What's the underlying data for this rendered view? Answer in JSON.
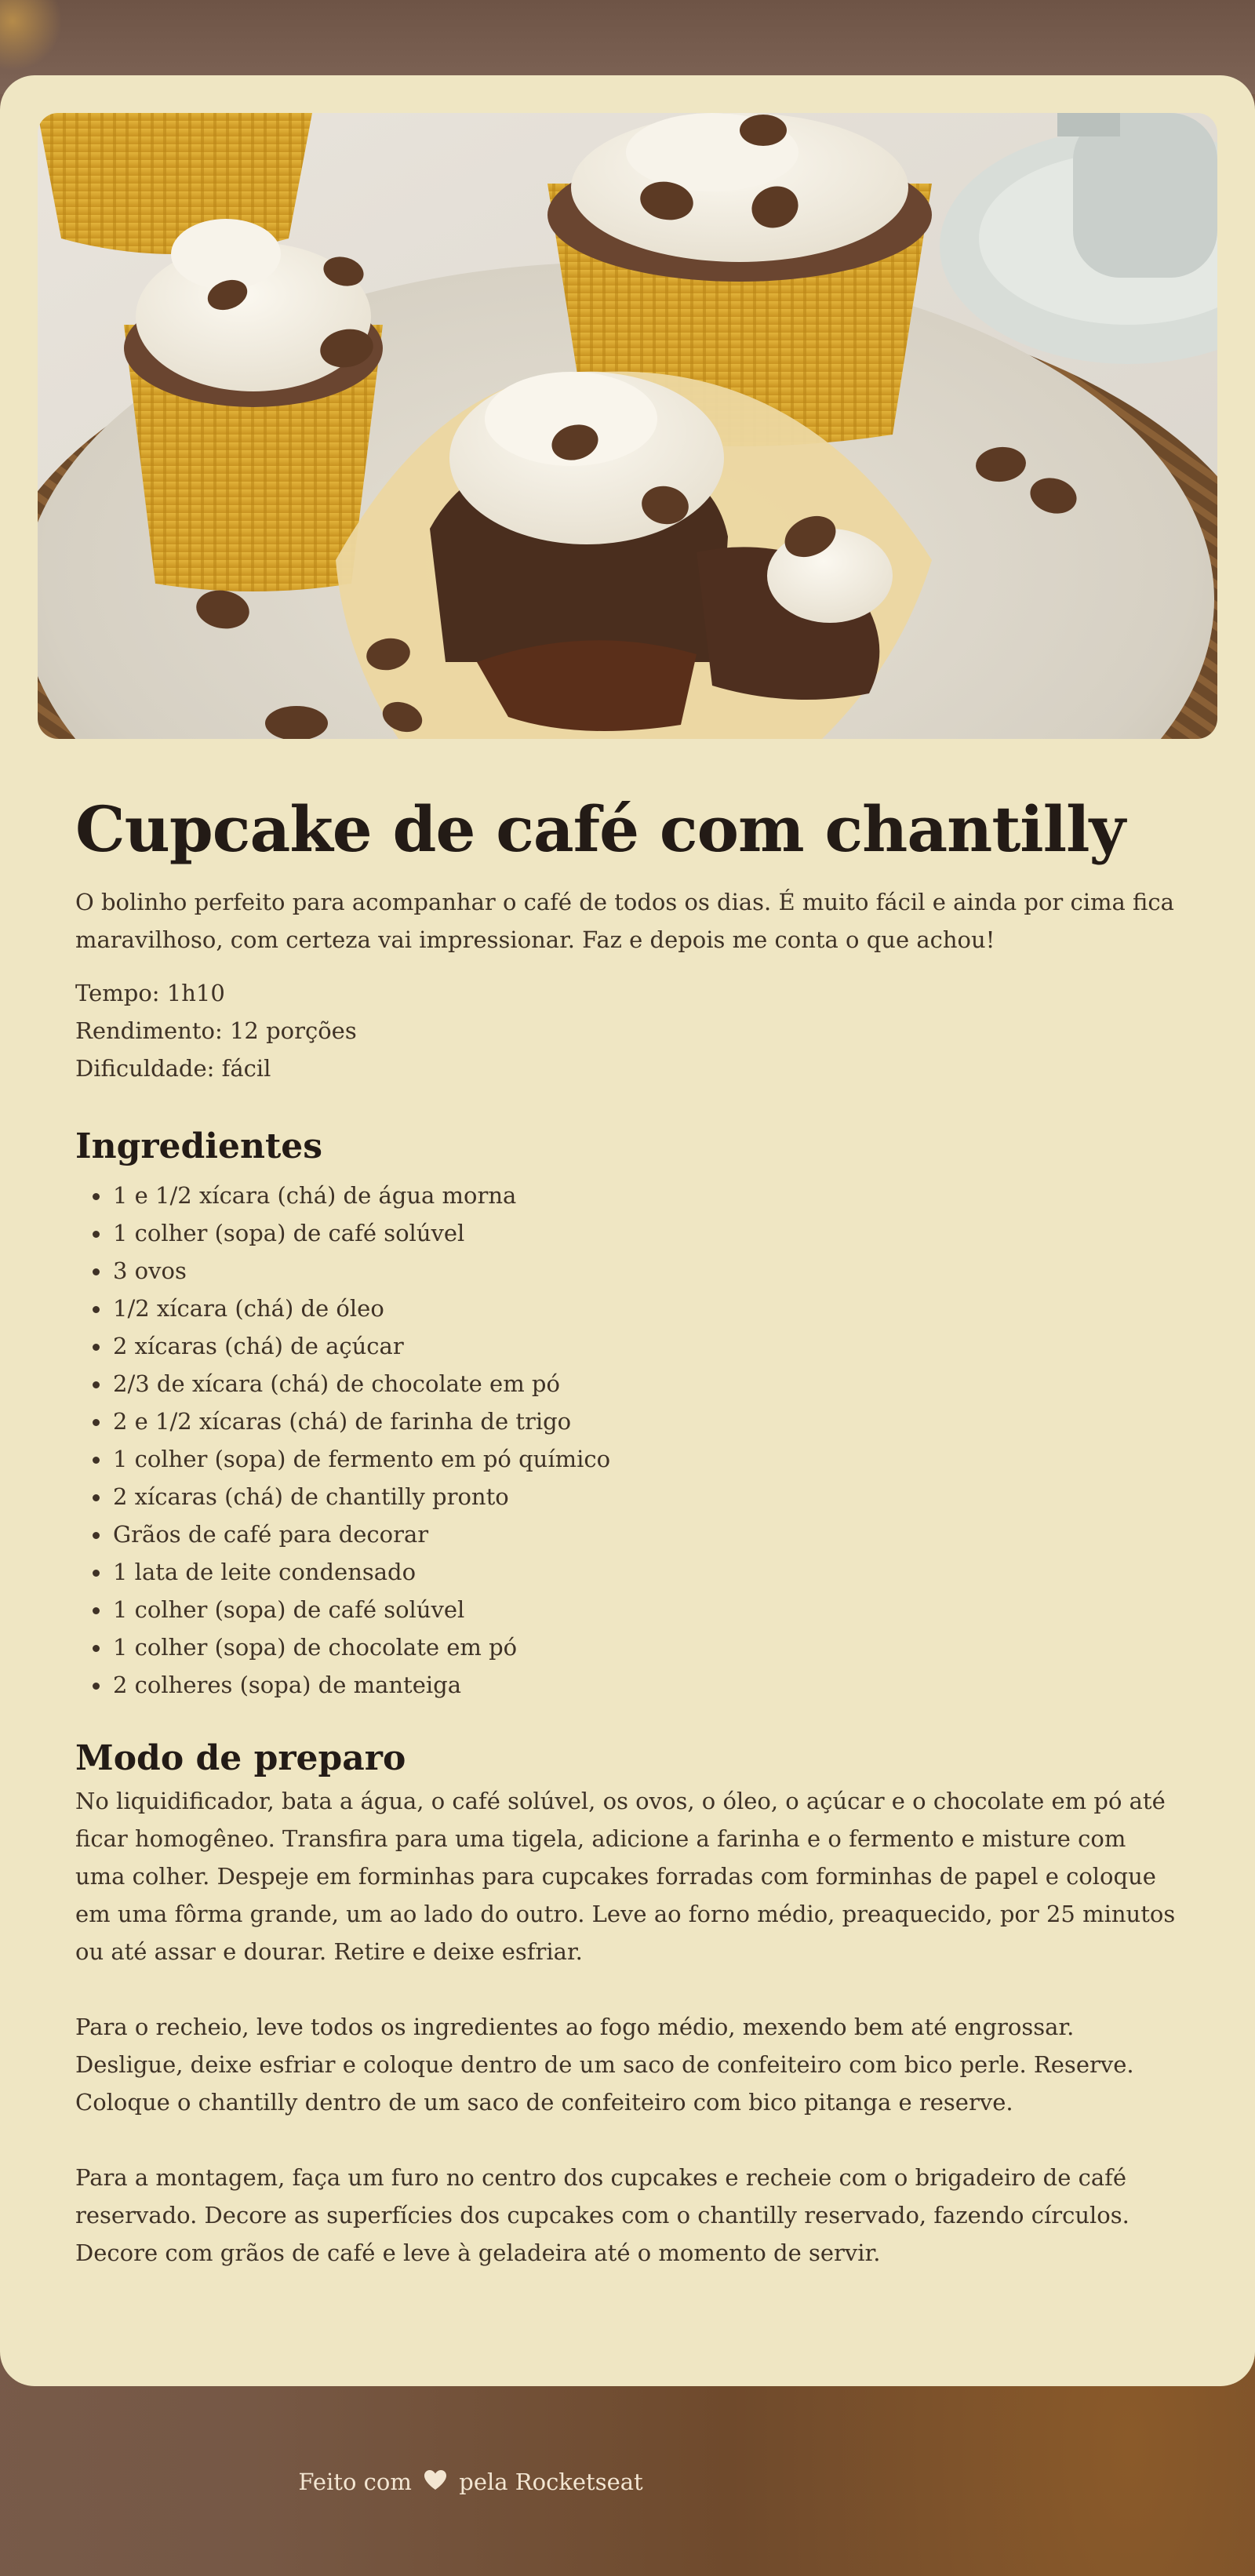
{
  "recipe": {
    "title": "Cupcake de café com chantilly",
    "description": "O bolinho perfeito para acompanhar o café de todos os dias. É muito fácil e ainda por cima fica maravilhoso, com certeza vai impressionar. Faz e depois me conta o que achou!",
    "time": "Tempo: 1h10",
    "yield": "Rendimento: 12 porções",
    "difficulty": "Dificuldade: fácil"
  },
  "ingredients": {
    "heading": "Ingredientes",
    "items": [
      "1 e 1/2 xícara (chá) de água morna",
      "1 colher (sopa) de café solúvel",
      "3 ovos",
      "1/2 xícara (chá) de óleo",
      "2 xícaras (chá) de açúcar",
      "2/3 de xícara (chá) de chocolate em pó",
      "2 e 1/2 xícaras (chá) de farinha de trigo",
      "1 colher (sopa) de fermento em pó químico",
      "2 xícaras (chá) de chantilly pronto",
      "Grãos de café para decorar",
      "1 lata de leite condensado",
      "1 colher (sopa) de café solúvel",
      "1 colher (sopa) de chocolate em pó",
      "2 colheres (sopa) de manteiga"
    ]
  },
  "preparation": {
    "heading": "Modo de preparo",
    "steps": [
      "No liquidificador, bata a água, o café solúvel, os ovos, o óleo, o açúcar e o chocolate em pó até ficar homogêneo. Transfira para uma tigela, adicione a farinha e o fermento e misture com uma colher. Despeje em forminhas para cupcakes forradas com forminhas de papel e coloque em uma fôrma grande, um ao lado do outro. Leve ao forno médio, preaquecido, por 25 minutos ou até assar e dourar. Retire e deixe esfriar.",
      "Para o recheio, leve todos os ingredientes ao fogo médio, mexendo bem até engrossar. Desligue, deixe esfriar e coloque dentro de um saco de confeiteiro com bico perle. Reserve. Coloque o chantilly dentro de um saco de confeiteiro com bico pitanga e reserve.",
      "Para a montagem, faça um furo no centro dos cupcakes e recheie com o brigadeiro de café reservado. Decore as superfícies dos cupcakes com o chantilly reservado, fazendo círculos. Decore com grãos de café e leve à geladeira até o momento de servir."
    ]
  },
  "footer": {
    "made_with": "Feito com",
    "by": "pela Rocketseat",
    "icon": "heart-icon"
  },
  "colors": {
    "card_background": "#efe6c3",
    "heading_text": "#231b16",
    "body_text": "#3f3226",
    "footer_text": "#f3e6d2"
  }
}
